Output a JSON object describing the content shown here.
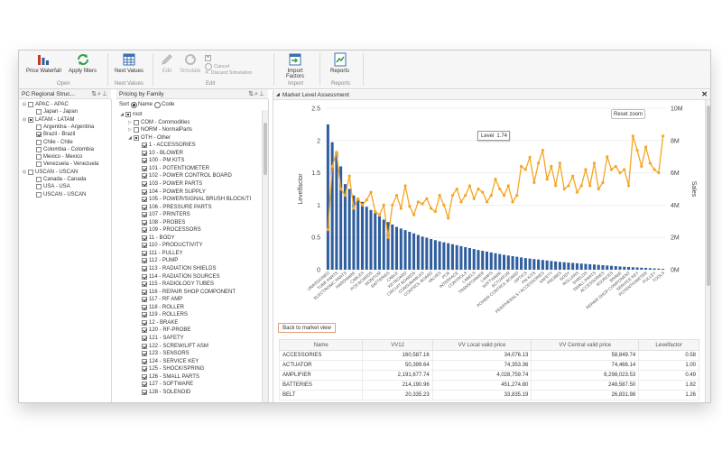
{
  "ribbon": {
    "price_waterfall": "Price Waterfall",
    "apply_filters": "Apply filters",
    "open_group": "Open",
    "next_values": "Next Values",
    "next_values_group": "Next Values",
    "edit": "Edit",
    "simulate": "Simulate",
    "cancel": "Cancel",
    "discard_simulation": "Discard Simulation",
    "edit_group": "Edit",
    "import_factors_1": "Import",
    "import_factors_2": "Factors",
    "import_group": "Import",
    "reports": "Reports",
    "reports_group": "Reports"
  },
  "left_tree": {
    "title": "PC Regional Struc...",
    "items": [
      {
        "label": "APAC - APAC",
        "level": 0,
        "state": "off",
        "exp": "⊟"
      },
      {
        "label": "Japan - Japan",
        "level": 1,
        "state": "off",
        "exp": ""
      },
      {
        "label": "LATAM - LATAM",
        "level": 0,
        "state": "part",
        "exp": "⊟"
      },
      {
        "label": "Argentina - Argentina",
        "level": 1,
        "state": "off",
        "exp": ""
      },
      {
        "label": "Brazil - Brazil",
        "level": 1,
        "state": "on",
        "exp": ""
      },
      {
        "label": "Chile - Chile",
        "level": 1,
        "state": "off",
        "exp": ""
      },
      {
        "label": "Colombia - Colombia",
        "level": 1,
        "state": "off",
        "exp": ""
      },
      {
        "label": "Mexico - Mexico",
        "level": 1,
        "state": "off",
        "exp": ""
      },
      {
        "label": "Venezuela - Venezuela",
        "level": 1,
        "state": "off",
        "exp": ""
      },
      {
        "label": "USCAN - USCAN",
        "level": 0,
        "state": "off",
        "exp": "⊟"
      },
      {
        "label": "Canada - Canada",
        "level": 1,
        "state": "off",
        "exp": ""
      },
      {
        "label": "USA - USA",
        "level": 1,
        "state": "off",
        "exp": ""
      },
      {
        "label": "USCAN - USCAN",
        "level": 1,
        "state": "off",
        "exp": ""
      }
    ]
  },
  "family_tree": {
    "title": "Pricing by Family",
    "sort_label": "Sort",
    "sort_name": "Name",
    "sort_code": "Code",
    "items": [
      {
        "label": "root",
        "level": 0,
        "state": "part",
        "exp": "◢"
      },
      {
        "label": "COM - Commodities",
        "level": 1,
        "state": "off",
        "exp": "▷"
      },
      {
        "label": "NORM - NormalParts",
        "level": 1,
        "state": "off",
        "exp": "▷"
      },
      {
        "label": "OTH - Other",
        "level": 1,
        "state": "part",
        "exp": "◢"
      },
      {
        "label": "1 - ACCESSORIES",
        "level": 2,
        "state": "on",
        "exp": ""
      },
      {
        "label": "10 - BLOWER",
        "level": 2,
        "state": "on",
        "exp": ""
      },
      {
        "label": "100 - PM KITS",
        "level": 2,
        "state": "on",
        "exp": ""
      },
      {
        "label": "101 - POTENTIOMETER",
        "level": 2,
        "state": "on",
        "exp": ""
      },
      {
        "label": "102 - POWER CONTROL BOARD",
        "level": 2,
        "state": "on",
        "exp": ""
      },
      {
        "label": "103 - POWER PARTS",
        "level": 2,
        "state": "on",
        "exp": ""
      },
      {
        "label": "104 - POWER SUPPLY",
        "level": 2,
        "state": "on",
        "exp": ""
      },
      {
        "label": "105 - POWER/SIGNAL BRUSH BLOCK/TI",
        "level": 2,
        "state": "on",
        "exp": ""
      },
      {
        "label": "106 - PRESSURE PARTS",
        "level": 2,
        "state": "on",
        "exp": ""
      },
      {
        "label": "107 - PRINTERS",
        "level": 2,
        "state": "on",
        "exp": ""
      },
      {
        "label": "108 - PROBES",
        "level": 2,
        "state": "on",
        "exp": ""
      },
      {
        "label": "109 - PROCESSORS",
        "level": 2,
        "state": "on",
        "exp": ""
      },
      {
        "label": "11 - BODY",
        "level": 2,
        "state": "on",
        "exp": ""
      },
      {
        "label": "110 - PRODUCTIVITY",
        "level": 2,
        "state": "on",
        "exp": ""
      },
      {
        "label": "111 - PULLEY",
        "level": 2,
        "state": "on",
        "exp": ""
      },
      {
        "label": "112 - PUMP",
        "level": 2,
        "state": "on",
        "exp": ""
      },
      {
        "label": "113 - RADIATION SHIELDS",
        "level": 2,
        "state": "on",
        "exp": ""
      },
      {
        "label": "114 - RADIATION SOURCES",
        "level": 2,
        "state": "on",
        "exp": ""
      },
      {
        "label": "115 - RADIOLOGY TUBES",
        "level": 2,
        "state": "on",
        "exp": ""
      },
      {
        "label": "116 - REPAIR SHOP COMPONENT",
        "level": 2,
        "state": "on",
        "exp": ""
      },
      {
        "label": "117 - RF AMP",
        "level": 2,
        "state": "on",
        "exp": ""
      },
      {
        "label": "118 - ROLLER",
        "level": 2,
        "state": "on",
        "exp": ""
      },
      {
        "label": "119 - ROLLERS",
        "level": 2,
        "state": "on",
        "exp": ""
      },
      {
        "label": "12 - BRAKE",
        "level": 2,
        "state": "on",
        "exp": ""
      },
      {
        "label": "120 - RF-PROBE",
        "level": 2,
        "state": "on",
        "exp": ""
      },
      {
        "label": "121 - SAFETY",
        "level": 2,
        "state": "on",
        "exp": ""
      },
      {
        "label": "122 - SCREW/LIFT ASM",
        "level": 2,
        "state": "on",
        "exp": ""
      },
      {
        "label": "123 - SENSORS",
        "level": 2,
        "state": "on",
        "exp": ""
      },
      {
        "label": "124 - SERVICE KEY",
        "level": 2,
        "state": "on",
        "exp": ""
      },
      {
        "label": "125 - SHOCK/SPRING",
        "level": 2,
        "state": "on",
        "exp": ""
      },
      {
        "label": "126 - SMALL PARTS",
        "level": 2,
        "state": "on",
        "exp": ""
      },
      {
        "label": "127 - SOFTWARE",
        "level": 2,
        "state": "on",
        "exp": ""
      },
      {
        "label": "128 - SOLENOID",
        "level": 2,
        "state": "on",
        "exp": ""
      }
    ]
  },
  "main": {
    "title": "Market Level Assessment",
    "reset_zoom": "Reset zoom",
    "tooltip_label": "Level",
    "tooltip_value": "1.74",
    "back_button": "Back to market view"
  },
  "chart_data": {
    "type": "bar",
    "ylabel": "Levelfactor",
    "y2label": "Sales",
    "ylim": [
      0,
      2.5
    ],
    "y2lim": [
      0,
      10000000
    ],
    "yticks": [
      "0",
      "0.5",
      "1",
      "1.5",
      "2",
      "2.5"
    ],
    "y2ticks": [
      "0M",
      "2M",
      "4M",
      "6M",
      "8M",
      "10M"
    ],
    "categories": [
      "UNASSIGNED",
      "POWER PARTS",
      "TUBE PARTS",
      "PATIENT TABLE",
      "ELECTRONIC PARTS",
      "COILS",
      "HARDWARE",
      "MECHANICS",
      "CABLES",
      "GANTRY",
      "PCB BOARDS",
      "COMPUTER",
      "MONITOR",
      "SENSORS",
      "BATTERIES",
      "FILTERS",
      "CABLE",
      "DETECTOR",
      "KEYBOARD",
      "MOTOR",
      "CIRCUIT BOARDS",
      "COOLING",
      "CONSUMABLES",
      "DRIVES",
      "CONTROL BOARD",
      "POWER SUPPLY",
      "VALVES",
      "SWITCHES",
      "PCB",
      "FANS",
      "INTERFACE",
      "POWER/SIGNAL BRUSH BLOCK",
      "CONTROLS",
      "PUMP",
      "LABELS",
      "BRACKETS",
      "TRANSFORMER",
      "DISPLAY",
      "LAMPS",
      "CONTROL UNIT",
      "SOFTWARE",
      "PERIPHERALS",
      "ACTUATOR",
      "CONNECTOR",
      "POWER CONTROL BOARD",
      "PROCESSORS",
      "OPTICS",
      "AMPLIFIER",
      "PM KITS",
      "TOOLS",
      "PERIPHERALS / ACCESSORIES",
      "RF AMP",
      "SAFETY",
      "GENERATOR",
      "PROBES",
      "PRINTERS",
      "BODY",
      "BLOWER",
      "ROLLERS",
      "SCREWS",
      "SHIELDS",
      "SEALS",
      "SMALL PARTS",
      "SOLENOID",
      "ACCESSORIES",
      "SPRINGS",
      "SOURCES",
      "TUBES",
      "BRAKE",
      "KITS",
      "REPAIR SHOP COMPONENT",
      "HOSES",
      "SERVICE KEY",
      "PRESSURE PARTS",
      "POTENTIOMETER",
      "BELT",
      "PULLEY",
      "LIFT",
      "TOOLS"
    ],
    "series": [
      {
        "name": "Sales",
        "axis": "right",
        "values": [
          9000000,
          7900000,
          7300000,
          6400000,
          5300000,
          5000000,
          4600000,
          4400000,
          4200000,
          3900000,
          3700000,
          3500000,
          3300000,
          3100000,
          2950000,
          2800000,
          2650000,
          2550000,
          2450000,
          2350000,
          2250000,
          2150000,
          2050000,
          1980000,
          1900000,
          1830000,
          1760000,
          1700000,
          1640000,
          1580000,
          1520000,
          1460000,
          1400000,
          1340000,
          1280000,
          1220000,
          1170000,
          1120000,
          1070000,
          1020000,
          970000,
          920000,
          880000,
          840000,
          800000,
          760000,
          720000,
          690000,
          660000,
          630000,
          600000,
          570000,
          540000,
          510000,
          480000,
          460000,
          440000,
          420000,
          400000,
          380000,
          360000,
          340000,
          320000,
          300000,
          280000,
          260000,
          240000,
          220000,
          200000,
          185000,
          170000,
          155000,
          140000,
          125000,
          110000,
          95000,
          80000,
          65000,
          50000
        ]
      },
      {
        "name": "Levelfactor",
        "axis": "left",
        "values": [
          0.62,
          1.6,
          1.82,
          1.25,
          1.15,
          1.45,
          0.95,
          1.1,
          1.0,
          1.08,
          1.2,
          0.9,
          0.85,
          1.0,
          0.5,
          1.0,
          1.15,
          0.95,
          1.3,
          0.98,
          0.85,
          1.05,
          1.02,
          1.1,
          0.95,
          0.9,
          1.15,
          1.0,
          0.8,
          1.15,
          1.25,
          1.05,
          1.15,
          1.3,
          1.1,
          1.25,
          1.2,
          1.05,
          1.15,
          1.4,
          1.25,
          1.15,
          1.3,
          1.05,
          1.15,
          1.6,
          1.55,
          1.74,
          1.35,
          1.65,
          1.85,
          1.4,
          1.6,
          1.3,
          1.65,
          1.25,
          1.3,
          1.45,
          1.2,
          1.3,
          1.55,
          1.3,
          1.65,
          1.25,
          1.35,
          1.75,
          1.55,
          1.6,
          1.5,
          1.55,
          1.3,
          2.07,
          1.85,
          1.6,
          1.9,
          1.65,
          1.55,
          1.5,
          2.07
        ]
      }
    ],
    "colors": {
      "bars": "#2f5e9e",
      "line": "#f5a623"
    }
  },
  "table": {
    "headers": [
      "Name",
      "VV12",
      "VV Local valid price",
      "VV Central valid price",
      "Levelfactor"
    ],
    "rows": [
      [
        "ACCESSORIES",
        "160,587.16",
        "34,076.13",
        "58,849.74",
        "0.58"
      ],
      [
        "ACTUATOR",
        "50,399.64",
        "74,353.36",
        "74,466.14",
        "1.00"
      ],
      [
        "AMPLIFIER",
        "2,191,677.74",
        "4,028,759.74",
        "8,298,023.53",
        "0.49"
      ],
      [
        "BATTERIES",
        "214,190.96",
        "451,274.80",
        "248,587.50",
        "1.82"
      ],
      [
        "BELT",
        "20,335.23",
        "33,835.19",
        "26,831.98",
        "1.26"
      ]
    ]
  }
}
